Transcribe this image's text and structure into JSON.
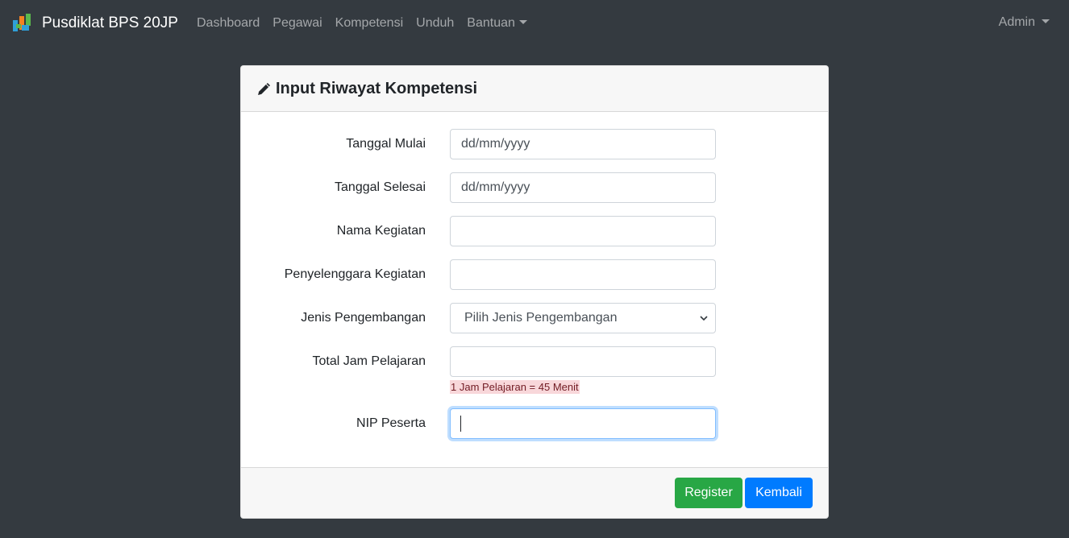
{
  "navbar": {
    "brand": "Pusdiklat BPS 20JP",
    "links": [
      "Dashboard",
      "Pegawai",
      "Kompetensi",
      "Unduh"
    ],
    "dropdown": "Bantuan",
    "user": "Admin"
  },
  "card": {
    "title": "Input Riwayat Kompetensi"
  },
  "form": {
    "tanggal_mulai": {
      "label": "Tanggal Mulai",
      "value": "dd/mm/yyyy"
    },
    "tanggal_selesai": {
      "label": "Tanggal Selesai",
      "value": "dd/mm/yyyy"
    },
    "nama_kegiatan": {
      "label": "Nama Kegiatan",
      "value": ""
    },
    "penyelenggara": {
      "label": "Penyelenggara Kegiatan",
      "value": ""
    },
    "jenis": {
      "label": "Jenis Pengembangan",
      "selected": "Pilih Jenis Pengembangan"
    },
    "total_jam": {
      "label": "Total Jam Pelajaran",
      "value": "",
      "help": "1 Jam Pelajaran = 45 Menit"
    },
    "nip": {
      "label": "NIP Peserta",
      "value": ""
    }
  },
  "buttons": {
    "register": "Register",
    "kembali": "Kembali"
  },
  "colors": {
    "navbar_bg": "#343a40",
    "success": "#28a745",
    "primary": "#007bff",
    "help_bg": "#f8d7da"
  },
  "icons": {
    "brand": "bps-logo-icon",
    "title": "pencil-icon",
    "select": "chevron-down-icon"
  }
}
